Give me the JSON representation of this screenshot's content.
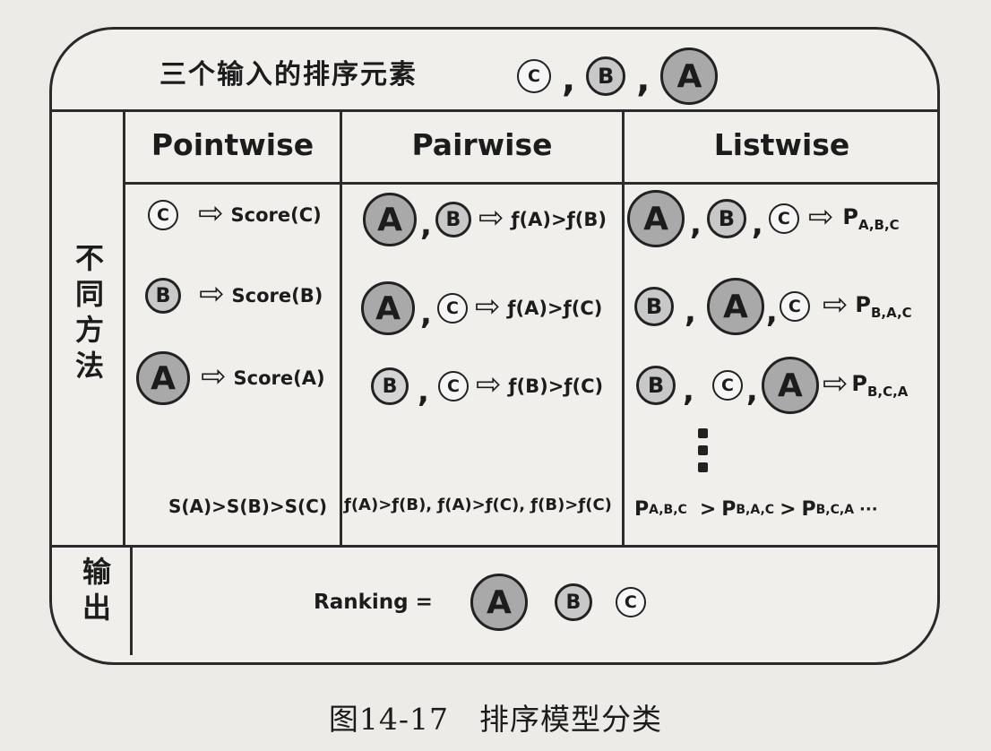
{
  "header": {
    "title": "三个输入的排序元素",
    "inputs": [
      "C",
      "B",
      "A"
    ]
  },
  "columns": [
    "Pointwise",
    "Pairwise",
    "Listwise"
  ],
  "side_labels": {
    "methods": [
      "不",
      "同",
      "方",
      "法"
    ],
    "output": [
      "输",
      "出"
    ]
  },
  "pointwise": {
    "rows": [
      {
        "circle": "C",
        "result": "Score(C)"
      },
      {
        "circle": "B",
        "result": "Score(B)"
      },
      {
        "circle": "A",
        "result": "Score(A)"
      }
    ],
    "summary": "S(A)>S(B)>S(C)"
  },
  "pairwise": {
    "rows": [
      {
        "left": "A",
        "right": "B",
        "result": "ƒ(A)>ƒ(B)"
      },
      {
        "left": "A",
        "right": "C",
        "result": "ƒ(A)>ƒ(C)"
      },
      {
        "left": "B",
        "right": "C",
        "result": "ƒ(B)>ƒ(C)"
      }
    ],
    "summary": "ƒ(A)>ƒ(B), ƒ(A)>ƒ(C), ƒ(B)>ƒ(C)"
  },
  "listwise": {
    "rows": [
      {
        "items": [
          "A",
          "B",
          "C"
        ],
        "p": "P",
        "sub": "A,B,C"
      },
      {
        "items": [
          "B",
          "A",
          "C"
        ],
        "p": "P",
        "sub": "B,A,C"
      },
      {
        "items": [
          "B",
          "C",
          "A"
        ],
        "p": "P",
        "sub": "B,C,A"
      }
    ],
    "summary": {
      "p1": "P",
      "s1": "A,B,C",
      "gt": ">",
      "p2": "P",
      "s2": "B,A,C",
      "p3": "P",
      "s3": "B,C,A",
      "ellipsis": "···"
    }
  },
  "output": {
    "label": "Ranking =",
    "items": [
      "A",
      "B",
      "C"
    ]
  },
  "arrow_glyph": "⇨",
  "comma": ",",
  "caption": "图14-17　排序模型分类"
}
